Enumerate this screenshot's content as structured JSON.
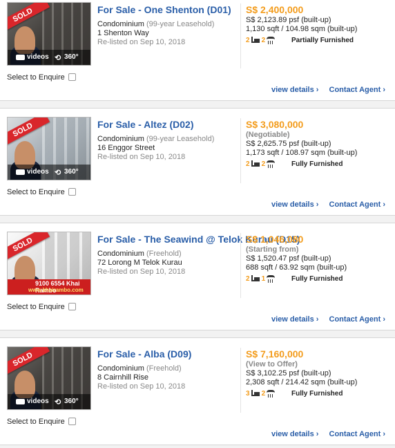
{
  "listings": [
    {
      "title": "For Sale - One Shenton (D01)",
      "type": "Condominium",
      "tenure": "(99-year Leasehold)",
      "address": "1 Shenton Way",
      "relisted": "Re-listed on Sep 10, 2018",
      "price": "S$ 2,400,000",
      "price_note": "",
      "psf": "S$ 2,123.89 psf (built-up)",
      "area": "1,130 sqft / 104.98 sqm (built-up)",
      "beds": "2",
      "baths": "2",
      "furnishing": "Partially Furnished",
      "badge": "SOLD",
      "media": {
        "videos": "videos",
        "v360": "360°"
      },
      "enquire_label": "Select to Enquire",
      "view_details": "view details ›",
      "contact_agent": "Contact Agent ›"
    },
    {
      "title": "For Sale - Altez (D02)",
      "type": "Condominium",
      "tenure": "(99-year Leasehold)",
      "address": "16 Enggor Street",
      "relisted": "Re-listed on Sep 10, 2018",
      "price": "S$ 3,080,000",
      "price_note": "(Negotiable)",
      "psf": "S$ 2,625.75 psf (built-up)",
      "area": "1,173 sqft / 108.97 sqm (built-up)",
      "beds": "2",
      "baths": "2",
      "furnishing": "Fully Furnished",
      "badge": "SOLD",
      "media": {
        "videos": "videos",
        "v360": "360°"
      },
      "enquire_label": "Select to Enquire",
      "view_details": "view details ›",
      "contact_agent": "Contact Agent ›"
    },
    {
      "title": "For Sale - The Seawind @ Telok Kurau (D15)",
      "type": "Condominium",
      "tenure": "(Freehold)",
      "address": "72 Lorong M Telok Kurau",
      "relisted": "Re-listed on Sep 10, 2018",
      "price": "S$ 1,046,080",
      "price_note": "(Starting from)",
      "psf": "S$ 1,520.47 psf (built-up)",
      "area": "688 sqft / 63.92 sqm (built-up)",
      "beds": "2",
      "baths": "1",
      "furnishing": "Fully Furnished",
      "badge": "SOLD",
      "contact": {
        "phone": "9100 6554  Khai Rambo",
        "site": "www.khairambo.com"
      },
      "enquire_label": "Select to Enquire",
      "view_details": "view details ›",
      "contact_agent": "Contact Agent ›"
    },
    {
      "title": "For Sale - Alba (D09)",
      "type": "Condominium",
      "tenure": "(Freehold)",
      "address": "8 Cairnhill Rise",
      "relisted": "Re-listed on Sep 10, 2018",
      "price": "S$ 7,160,000",
      "price_note": "(View to Offer)",
      "psf": "S$ 3,102.25 psf (built-up)",
      "area": "2,308 sqft / 214.42 sqm (built-up)",
      "beds": "3",
      "baths": "2",
      "furnishing": "Fully Furnished",
      "badge": "SOLD",
      "media": {
        "videos": "videos",
        "v360": "360°"
      },
      "enquire_label": "Select to Enquire",
      "view_details": "view details ›",
      "contact_agent": "Contact Agent ›"
    }
  ],
  "colors": {
    "title_blue": "#2a5ea8",
    "price_orange": "#f39c1c",
    "sold_red": "#d9262b"
  },
  "icons": [
    "video-camera-icon",
    "rotate-360-icon",
    "bed-icon",
    "bath-icon"
  ]
}
